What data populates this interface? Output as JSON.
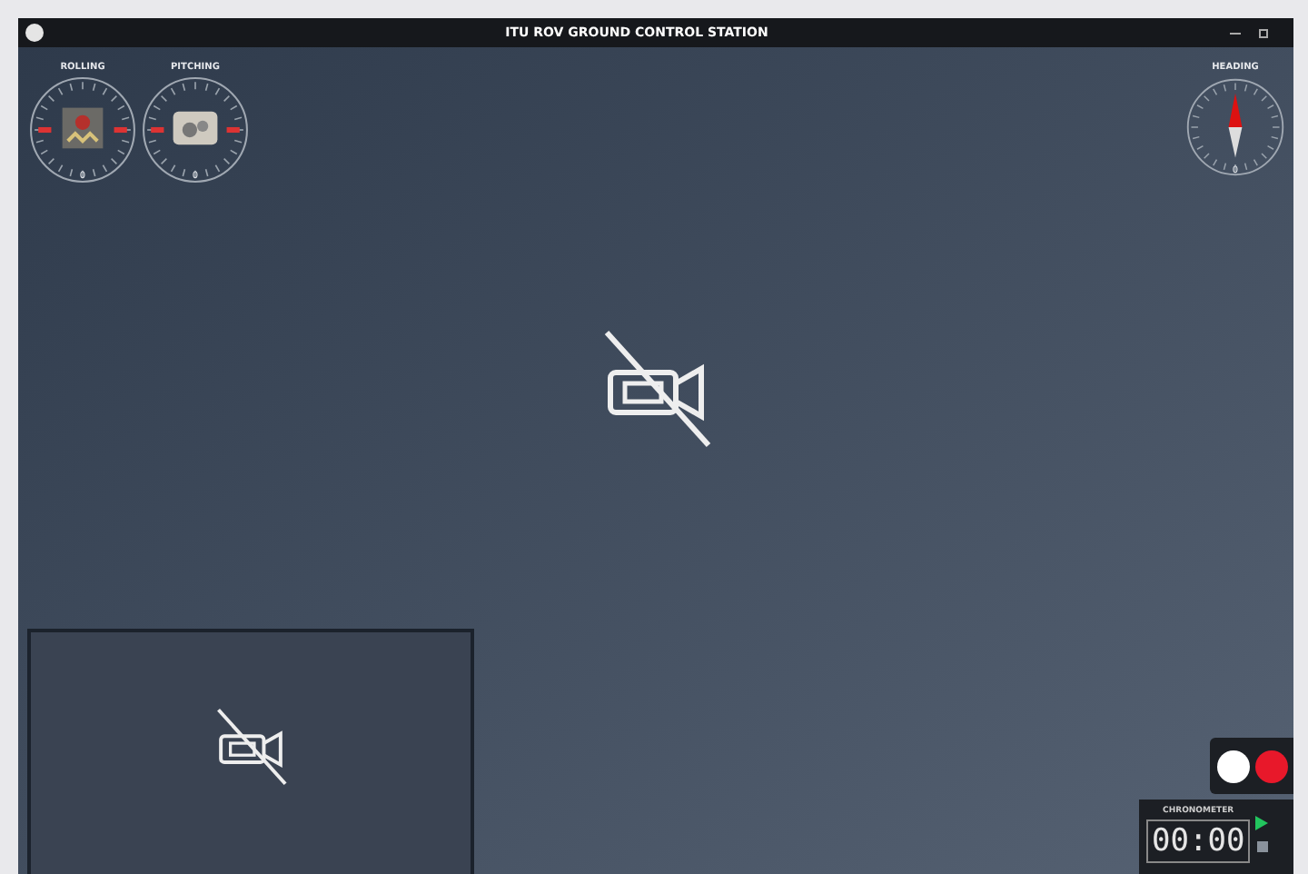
{
  "window": {
    "title": "ITU ROV GROUND CONTROL STATION"
  },
  "gauges": [
    {
      "kind": "roll",
      "label": "ROLLING",
      "reading": "0"
    },
    {
      "kind": "pitch",
      "label": "PITCHING",
      "reading": "0"
    }
  ],
  "heading": {
    "label": "HEADING",
    "reading": "0"
  },
  "recording": {
    "on": false
  },
  "chronometer": {
    "label": "CHRONOMETER",
    "time": "00:00",
    "running": false
  }
}
